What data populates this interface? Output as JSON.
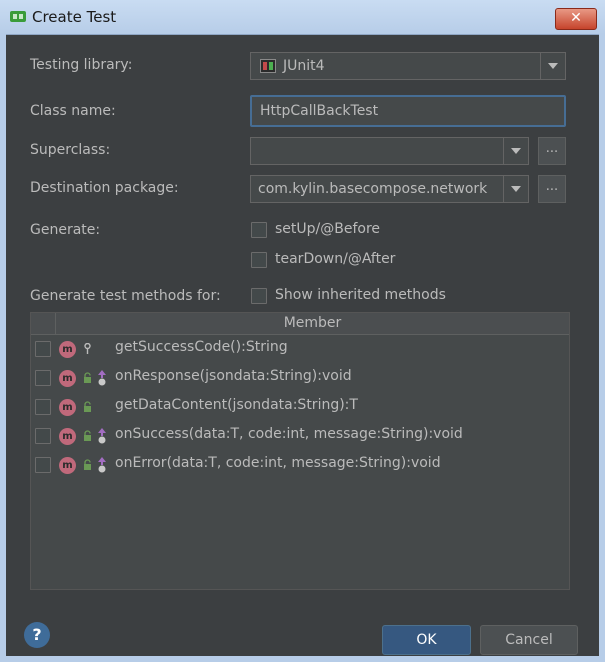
{
  "window": {
    "title": "Create Test",
    "close_glyph": "✕"
  },
  "form": {
    "testing_library_label": "Testing library:",
    "testing_library_value": "JUnit4",
    "class_name_label": "Class name:",
    "class_name_value": "HttpCallBackTest",
    "superclass_label": "Superclass:",
    "superclass_value": "",
    "destination_package_label": "Destination package:",
    "destination_package_value": "com.kylin.basecompose.network",
    "browse_label": "...",
    "generate_label": "Generate:",
    "setup_label": "setUp/@Before",
    "teardown_label": "tearDown/@After",
    "generate_methods_label": "Generate test methods for:",
    "show_inherited_label": "Show inherited methods"
  },
  "members": {
    "header": "Member",
    "rows": [
      {
        "signature": "getSuccessCode():String",
        "icon": "m",
        "visibility": "public-pin",
        "override": false
      },
      {
        "signature": "onResponse(jsondata:String):void",
        "icon": "m",
        "visibility": "lock",
        "override": true
      },
      {
        "signature": "getDataContent(jsondata:String):T",
        "icon": "m",
        "visibility": "lock",
        "override": false
      },
      {
        "signature": "onSuccess(data:T, code:int, message:String):void",
        "icon": "m",
        "visibility": "lock",
        "override": true
      },
      {
        "signature": "onError(data:T, code:int, message:String):void",
        "icon": "m",
        "visibility": "lock",
        "override": true
      }
    ]
  },
  "footer": {
    "help": "?",
    "ok_label": "OK",
    "cancel_label": "Cancel"
  },
  "colors": {
    "background": "#3c3f41",
    "accent": "#365880",
    "method_icon": "#c0697b",
    "lock_icon": "#6a9955",
    "override_icon": "#a26dc2"
  }
}
